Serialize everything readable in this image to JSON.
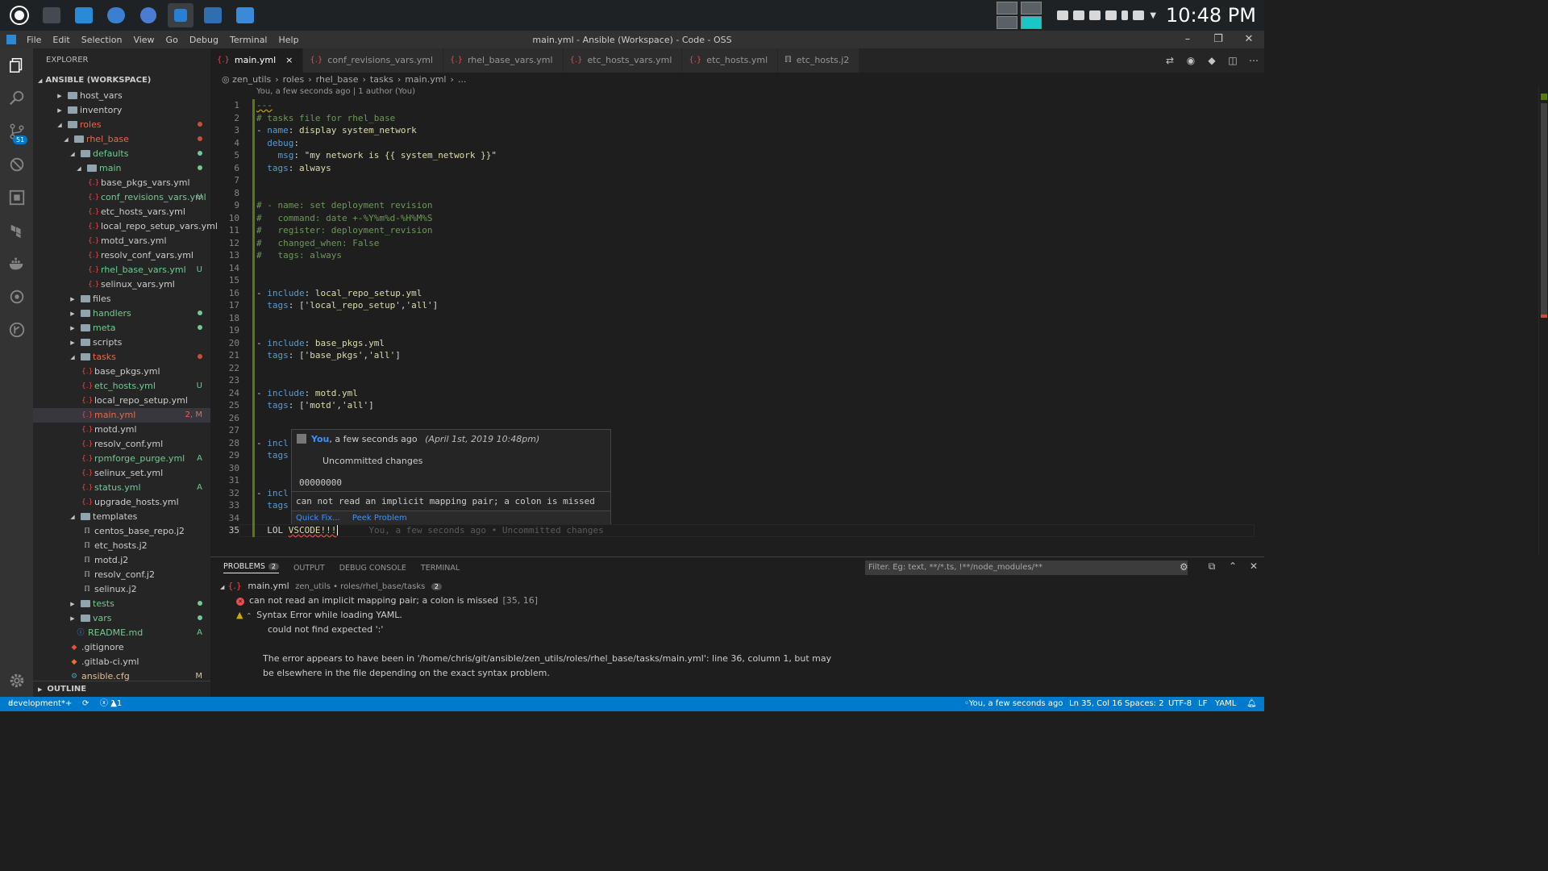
{
  "taskbar": {
    "apps": [
      "menu-icon",
      "taskmanager-icon",
      "files-icon",
      "thunderbird-icon",
      "chromium-icon",
      "vscode-icon",
      "writer-icon",
      "screenshot-icon"
    ],
    "clock": "10:48 PM"
  },
  "window": {
    "title": "main.yml - Ansible (Workspace) - Code - OSS",
    "menu": [
      "File",
      "Edit",
      "Selection",
      "View",
      "Go",
      "Debug",
      "Terminal",
      "Help"
    ]
  },
  "activity": {
    "scm_badge": "51"
  },
  "explorer": {
    "header": "EXPLORER",
    "workspace": "ANSIBLE (WORKSPACE)",
    "outline": "OUTLINE",
    "rows": [
      {
        "label": "host_vars",
        "kind": "folder",
        "depth": 1,
        "state": "collapsed",
        "color": "#cccccc",
        "status": "",
        "status_color": ""
      },
      {
        "label": "inventory",
        "kind": "folder",
        "depth": 1,
        "state": "collapsed",
        "color": "#cccccc",
        "status": "",
        "status_color": ""
      },
      {
        "label": "roles",
        "kind": "folder",
        "depth": 1,
        "state": "expanded",
        "color": "#e06c4c",
        "status": "dot",
        "status_color": "#c74e39"
      },
      {
        "label": "rhel_base",
        "kind": "folder",
        "depth": 2,
        "state": "expanded",
        "color": "#e06c4c",
        "status": "dot",
        "status_color": "#c74e39"
      },
      {
        "label": "defaults",
        "kind": "folder",
        "depth": 3,
        "state": "expanded",
        "color": "#73c991",
        "status": "dot",
        "status_color": "#73c991"
      },
      {
        "label": "main",
        "kind": "folder",
        "depth": 4,
        "state": "expanded",
        "color": "#73c991",
        "status": "dot",
        "status_color": "#73c991"
      },
      {
        "label": "base_pkgs_vars.yml",
        "kind": "yml",
        "depth": 5,
        "state": "",
        "color": "#cccccc",
        "status": "",
        "status_color": ""
      },
      {
        "label": "conf_revisions_vars.yml",
        "kind": "yml",
        "depth": 5,
        "state": "",
        "color": "#73c991",
        "status": "U",
        "status_color": "#73c991"
      },
      {
        "label": "etc_hosts_vars.yml",
        "kind": "yml",
        "depth": 5,
        "state": "",
        "color": "#cccccc",
        "status": "",
        "status_color": ""
      },
      {
        "label": "local_repo_setup_vars.yml",
        "kind": "yml",
        "depth": 5,
        "state": "",
        "color": "#cccccc",
        "status": "",
        "status_color": ""
      },
      {
        "label": "motd_vars.yml",
        "kind": "yml",
        "depth": 5,
        "state": "",
        "color": "#cccccc",
        "status": "",
        "status_color": ""
      },
      {
        "label": "resolv_conf_vars.yml",
        "kind": "yml",
        "depth": 5,
        "state": "",
        "color": "#cccccc",
        "status": "",
        "status_color": ""
      },
      {
        "label": "rhel_base_vars.yml",
        "kind": "yml",
        "depth": 5,
        "state": "",
        "color": "#73c991",
        "status": "U",
        "status_color": "#73c991"
      },
      {
        "label": "selinux_vars.yml",
        "kind": "yml",
        "depth": 5,
        "state": "",
        "color": "#cccccc",
        "status": "",
        "status_color": ""
      },
      {
        "label": "files",
        "kind": "folder",
        "depth": 3,
        "state": "collapsed",
        "color": "#cccccc",
        "status": "",
        "status_color": ""
      },
      {
        "label": "handlers",
        "kind": "folder",
        "depth": 3,
        "state": "collapsed",
        "color": "#73c991",
        "status": "dot",
        "status_color": "#73c991"
      },
      {
        "label": "meta",
        "kind": "folder",
        "depth": 3,
        "state": "collapsed",
        "color": "#73c991",
        "status": "dot",
        "status_color": "#73c991"
      },
      {
        "label": "scripts",
        "kind": "folder",
        "depth": 3,
        "state": "collapsed",
        "color": "#cccccc",
        "status": "",
        "status_color": ""
      },
      {
        "label": "tasks",
        "kind": "folder",
        "depth": 3,
        "state": "expanded",
        "color": "#e06c4c",
        "status": "dot",
        "status_color": "#c74e39"
      },
      {
        "label": "base_pkgs.yml",
        "kind": "yml",
        "depth": 4,
        "state": "",
        "color": "#cccccc",
        "status": "",
        "status_color": ""
      },
      {
        "label": "etc_hosts.yml",
        "kind": "yml",
        "depth": 4,
        "state": "",
        "color": "#73c991",
        "status": "U",
        "status_color": "#73c991"
      },
      {
        "label": "local_repo_setup.yml",
        "kind": "yml",
        "depth": 4,
        "state": "",
        "color": "#cccccc",
        "status": "",
        "status_color": ""
      },
      {
        "label": "main.yml",
        "kind": "yml",
        "depth": 4,
        "state": "",
        "color": "#e06c4c",
        "status": "2, M",
        "status_color": "#e06c4c"
      },
      {
        "label": "motd.yml",
        "kind": "yml",
        "depth": 4,
        "state": "",
        "color": "#cccccc",
        "status": "",
        "status_color": ""
      },
      {
        "label": "resolv_conf.yml",
        "kind": "yml",
        "depth": 4,
        "state": "",
        "color": "#cccccc",
        "status": "",
        "status_color": ""
      },
      {
        "label": "rpmforge_purge.yml",
        "kind": "yml",
        "depth": 4,
        "state": "",
        "color": "#73c991",
        "status": "A",
        "status_color": "#73c991"
      },
      {
        "label": "selinux_set.yml",
        "kind": "yml",
        "depth": 4,
        "state": "",
        "color": "#cccccc",
        "status": "",
        "status_color": ""
      },
      {
        "label": "status.yml",
        "kind": "yml",
        "depth": 4,
        "state": "",
        "color": "#73c991",
        "status": "A",
        "status_color": "#73c991"
      },
      {
        "label": "upgrade_hosts.yml",
        "kind": "yml",
        "depth": 4,
        "state": "",
        "color": "#cccccc",
        "status": "",
        "status_color": ""
      },
      {
        "label": "templates",
        "kind": "folder",
        "depth": 3,
        "state": "expanded",
        "color": "#cccccc",
        "status": "",
        "status_color": ""
      },
      {
        "label": "centos_base_repo.j2",
        "kind": "j2",
        "depth": 4,
        "state": "",
        "color": "#cccccc",
        "status": "",
        "status_color": ""
      },
      {
        "label": "etc_hosts.j2",
        "kind": "j2",
        "depth": 4,
        "state": "",
        "color": "#cccccc",
        "status": "",
        "status_color": ""
      },
      {
        "label": "motd.j2",
        "kind": "j2",
        "depth": 4,
        "state": "",
        "color": "#cccccc",
        "status": "",
        "status_color": ""
      },
      {
        "label": "resolv_conf.j2",
        "kind": "j2",
        "depth": 4,
        "state": "",
        "color": "#cccccc",
        "status": "",
        "status_color": ""
      },
      {
        "label": "selinux.j2",
        "kind": "j2",
        "depth": 4,
        "state": "",
        "color": "#cccccc",
        "status": "",
        "status_color": ""
      },
      {
        "label": "tests",
        "kind": "folder",
        "depth": 3,
        "state": "collapsed",
        "color": "#73c991",
        "status": "dot",
        "status_color": "#73c991"
      },
      {
        "label": "vars",
        "kind": "folder",
        "depth": 3,
        "state": "collapsed",
        "color": "#73c991",
        "status": "dot",
        "status_color": "#73c991"
      },
      {
        "label": "README.md",
        "kind": "info",
        "depth": 3,
        "state": "",
        "color": "#73c991",
        "status": "A",
        "status_color": "#73c991"
      },
      {
        "label": ".gitignore",
        "kind": "git",
        "depth": 2,
        "state": "",
        "color": "#cccccc",
        "status": "",
        "status_color": ""
      },
      {
        "label": ".gitlab-ci.yml",
        "kind": "gitlab",
        "depth": 2,
        "state": "",
        "color": "#cccccc",
        "status": "",
        "status_color": ""
      },
      {
        "label": "ansible.cfg",
        "kind": "cfg",
        "depth": 2,
        "state": "",
        "color": "#e2c08d",
        "status": "M",
        "status_color": "#e2c08d"
      }
    ]
  },
  "tabs": [
    {
      "label": "main.yml",
      "icon": "{.}",
      "active": true,
      "close": "×"
    },
    {
      "label": "conf_revisions_vars.yml",
      "icon": "{.}",
      "active": false,
      "close": ""
    },
    {
      "label": "rhel_base_vars.yml",
      "icon": "{.}",
      "active": false,
      "close": ""
    },
    {
      "label": "etc_hosts_vars.yml",
      "icon": "{.}",
      "active": false,
      "close": ""
    },
    {
      "label": "etc_hosts.yml",
      "icon": "{.}",
      "active": false,
      "close": ""
    },
    {
      "label": "etc_hosts.j2",
      "icon": "ℿ",
      "active": false,
      "close": ""
    }
  ],
  "breadcrumb": {
    "parts": [
      "zen_utils",
      "roles",
      "rhel_base",
      "tasks",
      "main.yml",
      "..."
    ],
    "sep": "›"
  },
  "codelens": "You, a few seconds ago | 1 author (You)",
  "code": {
    "current_line": 35,
    "lines": [
      [
        [
          "---",
          "c-cm"
        ]
      ],
      [
        [
          "# tasks file for rhel_base",
          "c-cm"
        ]
      ],
      [
        [
          "- ",
          ""
        ],
        [
          "name",
          "c-k"
        ],
        [
          ": ",
          ""
        ],
        [
          "display system_network",
          "c-y"
        ]
      ],
      [
        [
          "  ",
          ""
        ],
        [
          "debug",
          "c-k"
        ],
        [
          ":",
          ""
        ]
      ],
      [
        [
          "    ",
          ""
        ],
        [
          "msg",
          "c-k"
        ],
        [
          ": ",
          ""
        ],
        [
          "\"my network is {{ system_network }}\"",
          "c-y"
        ]
      ],
      [
        [
          "  ",
          ""
        ],
        [
          "tags",
          "c-k"
        ],
        [
          ": ",
          ""
        ],
        [
          "always",
          "c-y"
        ]
      ],
      [],
      [],
      [
        [
          "# - name: set deployment revision",
          "c-cm"
        ]
      ],
      [
        [
          "#   command: date +-%Y%m%d-%H%M%S",
          "c-cm"
        ]
      ],
      [
        [
          "#   register: deployment_revision",
          "c-cm"
        ]
      ],
      [
        [
          "#   changed_when: False",
          "c-cm"
        ]
      ],
      [
        [
          "#   tags: always",
          "c-cm"
        ]
      ],
      [],
      [],
      [
        [
          "- ",
          ""
        ],
        [
          "include",
          "c-k"
        ],
        [
          ": ",
          ""
        ],
        [
          "local_repo_setup.yml",
          "c-y"
        ]
      ],
      [
        [
          "  ",
          ""
        ],
        [
          "tags",
          "c-k"
        ],
        [
          ": [",
          ""
        ],
        [
          "'local_repo_setup'",
          "c-y"
        ],
        [
          ",",
          ""
        ],
        [
          "'all'",
          "c-y"
        ],
        [
          "]",
          ""
        ]
      ],
      [],
      [],
      [
        [
          "- ",
          ""
        ],
        [
          "include",
          "c-k"
        ],
        [
          ": ",
          ""
        ],
        [
          "base_pkgs.yml",
          "c-y"
        ]
      ],
      [
        [
          "  ",
          ""
        ],
        [
          "tags",
          "c-k"
        ],
        [
          ": [",
          ""
        ],
        [
          "'base_pkgs'",
          "c-y"
        ],
        [
          ",",
          ""
        ],
        [
          "'all'",
          "c-y"
        ],
        [
          "]",
          ""
        ]
      ],
      [],
      [],
      [
        [
          "- ",
          ""
        ],
        [
          "include",
          "c-k"
        ],
        [
          ": ",
          ""
        ],
        [
          "motd.yml",
          "c-y"
        ]
      ],
      [
        [
          "  ",
          ""
        ],
        [
          "tags",
          "c-k"
        ],
        [
          ": [",
          ""
        ],
        [
          "'motd'",
          "c-y"
        ],
        [
          ",",
          ""
        ],
        [
          "'all'",
          "c-y"
        ],
        [
          "]",
          ""
        ]
      ],
      [],
      [],
      [
        [
          "- ",
          ""
        ],
        [
          "incl",
          "c-k"
        ]
      ],
      [
        [
          "  ",
          ""
        ],
        [
          "tags",
          "c-k"
        ]
      ],
      [],
      [],
      [
        [
          "- ",
          ""
        ],
        [
          "incl",
          "c-k"
        ]
      ],
      [
        [
          "  ",
          ""
        ],
        [
          "tags",
          "c-k"
        ]
      ],
      [],
      [
        [
          "  LOL ",
          ""
        ],
        [
          "VSCODE!!!",
          "c-y"
        ]
      ]
    ],
    "blame": "You, a few seconds ago • Uncommitted changes"
  },
  "hover": {
    "author": "You",
    "when": ", a few seconds ago",
    "date": "(April 1st, 2019 10:48pm)",
    "message": "Uncommitted changes",
    "sha": "00000000",
    "error": "can not read an implicit mapping pair; a colon is missed",
    "action1": "Quick Fix...",
    "action2": "Peek Problem"
  },
  "panel": {
    "tabs": [
      "PROBLEMS",
      "OUTPUT",
      "DEBUG CONSOLE",
      "TERMINAL"
    ],
    "problems_count": "2",
    "filter_placeholder": "Filter. Eg: text, **/*.ts, !**/node_modules/**",
    "file": "main.yml",
    "file_path": "zen_utils • roles/rhel_base/tasks",
    "file_count": "2",
    "error1": "can not read an implicit mapping pair; a colon is missed",
    "error1_pos": "[35, 16]",
    "warn1": "Syntax Error while loading YAML.",
    "warn_line2": "could not find expected ':'",
    "warn_line3": "The error appears to have been in '/home/chris/git/ansible/zen_utils/roles/rhel_base/tasks/main.yml': line 36, column 1, but may",
    "warn_line4": "be elsewhere in the file depending on the exact syntax problem."
  },
  "status": {
    "branch": "development*+",
    "errors": "1",
    "warnings": "1",
    "blame": "You, a few seconds ago",
    "position": "Ln 35, Col 16",
    "spaces": "Spaces: 2",
    "encoding": "UTF-8",
    "eol": "LF",
    "language": "YAML"
  },
  "colors": {
    "accent": "#007acc",
    "modified": "#e2c08d",
    "untracked": "#73c991",
    "error": "#e06c4c"
  }
}
